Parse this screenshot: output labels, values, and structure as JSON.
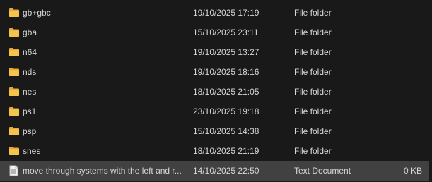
{
  "rows": [
    {
      "name": "gb+gbc",
      "date": "19/10/2025 17:19",
      "type": "File folder",
      "size": "",
      "icon": "folder-icon"
    },
    {
      "name": "gba",
      "date": "15/10/2025 23:11",
      "type": "File folder",
      "size": "",
      "icon": "folder-icon"
    },
    {
      "name": "n64",
      "date": "19/10/2025 13:27",
      "type": "File folder",
      "size": "",
      "icon": "folder-icon"
    },
    {
      "name": "nds",
      "date": "19/10/2025 18:16",
      "type": "File folder",
      "size": "",
      "icon": "folder-icon"
    },
    {
      "name": "nes",
      "date": "18/10/2025 21:05",
      "type": "File folder",
      "size": "",
      "icon": "folder-icon"
    },
    {
      "name": "ps1",
      "date": "23/10/2025 19:18",
      "type": "File folder",
      "size": "",
      "icon": "folder-icon"
    },
    {
      "name": "psp",
      "date": "15/10/2025 14:38",
      "type": "File folder",
      "size": "",
      "icon": "folder-icon"
    },
    {
      "name": "snes",
      "date": "18/10/2025 21:19",
      "type": "File folder",
      "size": "",
      "icon": "folder-icon"
    },
    {
      "name": "move through systems with the left and r...",
      "date": "14/10/2025 22:50",
      "type": "Text Document",
      "size": "0 KB",
      "icon": "text-file-icon",
      "selected": true
    }
  ],
  "colors": {
    "background": "#191919",
    "text": "#d7d7d7",
    "selected_row": "#414141",
    "folder": "#f5c44c"
  }
}
